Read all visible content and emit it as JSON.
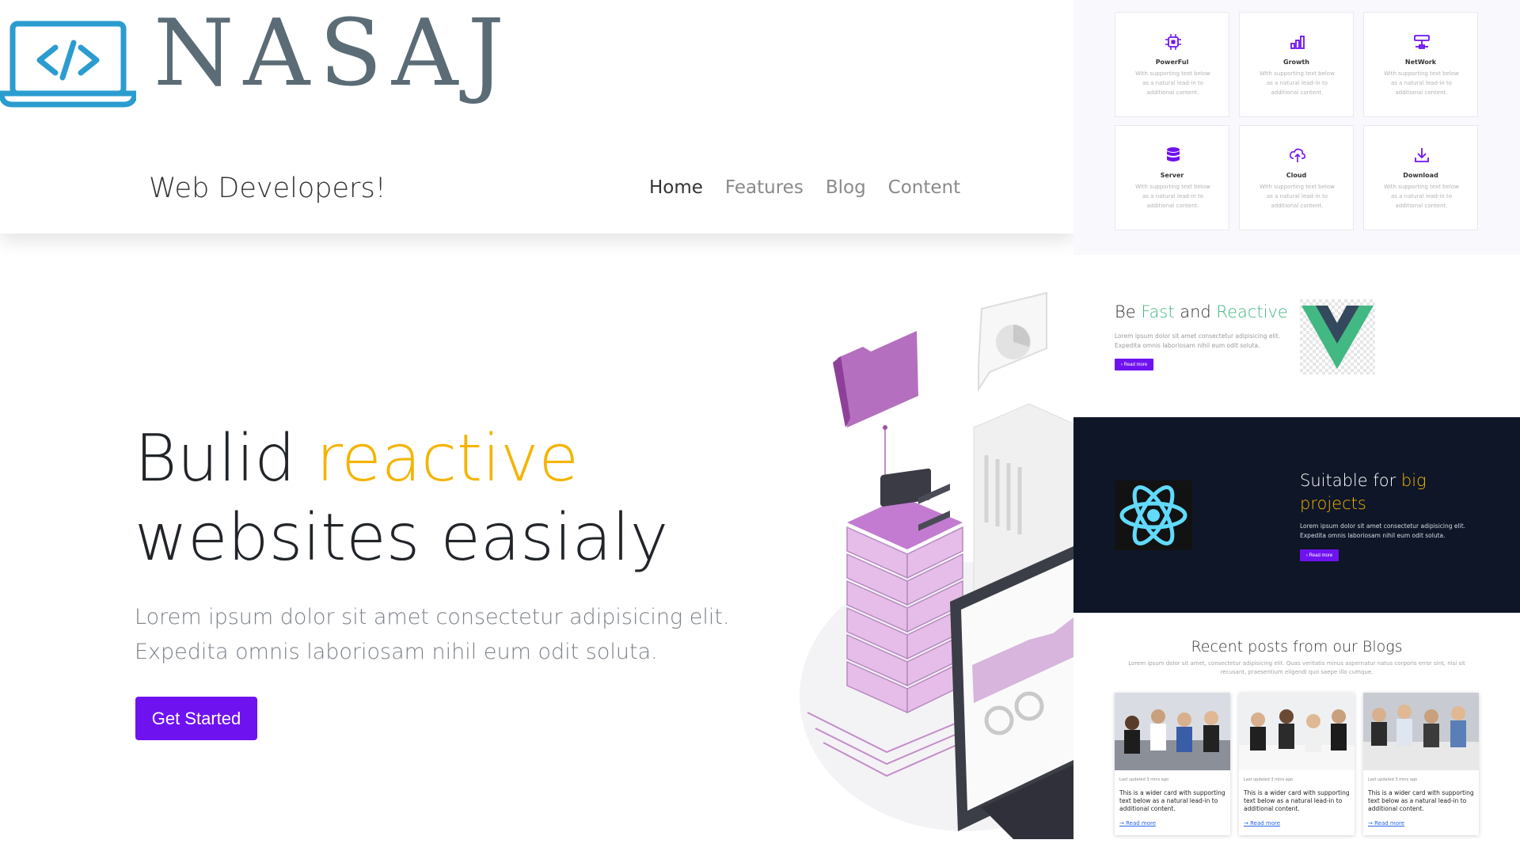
{
  "brand": {
    "name": "NASAJ",
    "tagline": "Web Developers!"
  },
  "nav": {
    "items": [
      "Home",
      "Features",
      "Blog",
      "Content"
    ],
    "active": "Home"
  },
  "hero": {
    "title_pre": "Bulid ",
    "title_accent": "reactive",
    "title_post": " websites easialy",
    "text": "Lorem ipsum dolor sit amet consectetur adipisicing elit. Expedita omnis laboriosam nihil eum odit soluta.",
    "button": "Get Started"
  },
  "features": [
    {
      "icon": "chip-icon",
      "title": "PowerFul",
      "text": "With supporting text below as a natural lead-in to additional content."
    },
    {
      "icon": "bar-chart-icon",
      "title": "Growth",
      "text": "With supporting text below as a natural lead-in to additional content."
    },
    {
      "icon": "network-icon",
      "title": "NetWork",
      "text": "With supporting text below as a natural lead-in to additional content."
    },
    {
      "icon": "database-icon",
      "title": "Server",
      "text": "With supporting text below as a natural lead-in to additional content."
    },
    {
      "icon": "cloud-upload-icon",
      "title": "Cloud",
      "text": "With supporting text below as a natural lead-in to additional content."
    },
    {
      "icon": "download-icon",
      "title": "Download",
      "text": "With supporting text below as a natural lead-in to additional content."
    }
  ],
  "vue_section": {
    "title_1": "Be ",
    "title_2": "Fast",
    "title_3": " and ",
    "title_4": "Reactive",
    "text": "Lorem ipsum dolor sit amet consectetur adipisicing elit. Expedita omnis laboriosam nihil eum odit soluta.",
    "button": "› Read more"
  },
  "react_section": {
    "title_1": "Suitable for ",
    "title_2": "big projects",
    "text": "Lorem ipsum dolor sit amet consectetur adipisicing elit. Expedita omnis laboriosam nihil eum odit soluta.",
    "button": "› Read more"
  },
  "blog": {
    "title": "Recent posts from our Blogs",
    "subtitle": "Lorem ipsum dolor sit amet, consectetur adipisicing elit. Quas veritatis minus aspernatur natus corporis error sint, nisi sit recusant, praesentium eligendi quo saepe illo cumque.",
    "cards": [
      {
        "meta": "Last updated 3 mins ago",
        "text": "This is a wider card with supporting text below as a natural lead-in to additional content.",
        "link": "→ Read more"
      },
      {
        "meta": "Last updated 3 mins ago",
        "text": "This is a wider card with supporting text below as a natural lead-in to additional content.",
        "link": "→ Read more"
      },
      {
        "meta": "Last updated 3 mins ago",
        "text": "This is a wider card with supporting text below as a natural lead-in to additional content.",
        "link": "→ Read more"
      }
    ]
  },
  "colors": {
    "accent_purple": "#6f12f0",
    "accent_yellow": "#f4b400",
    "vue_green": "#42b883",
    "dark_navy": "#0e1628",
    "logo_blue": "#2b9ccf"
  }
}
